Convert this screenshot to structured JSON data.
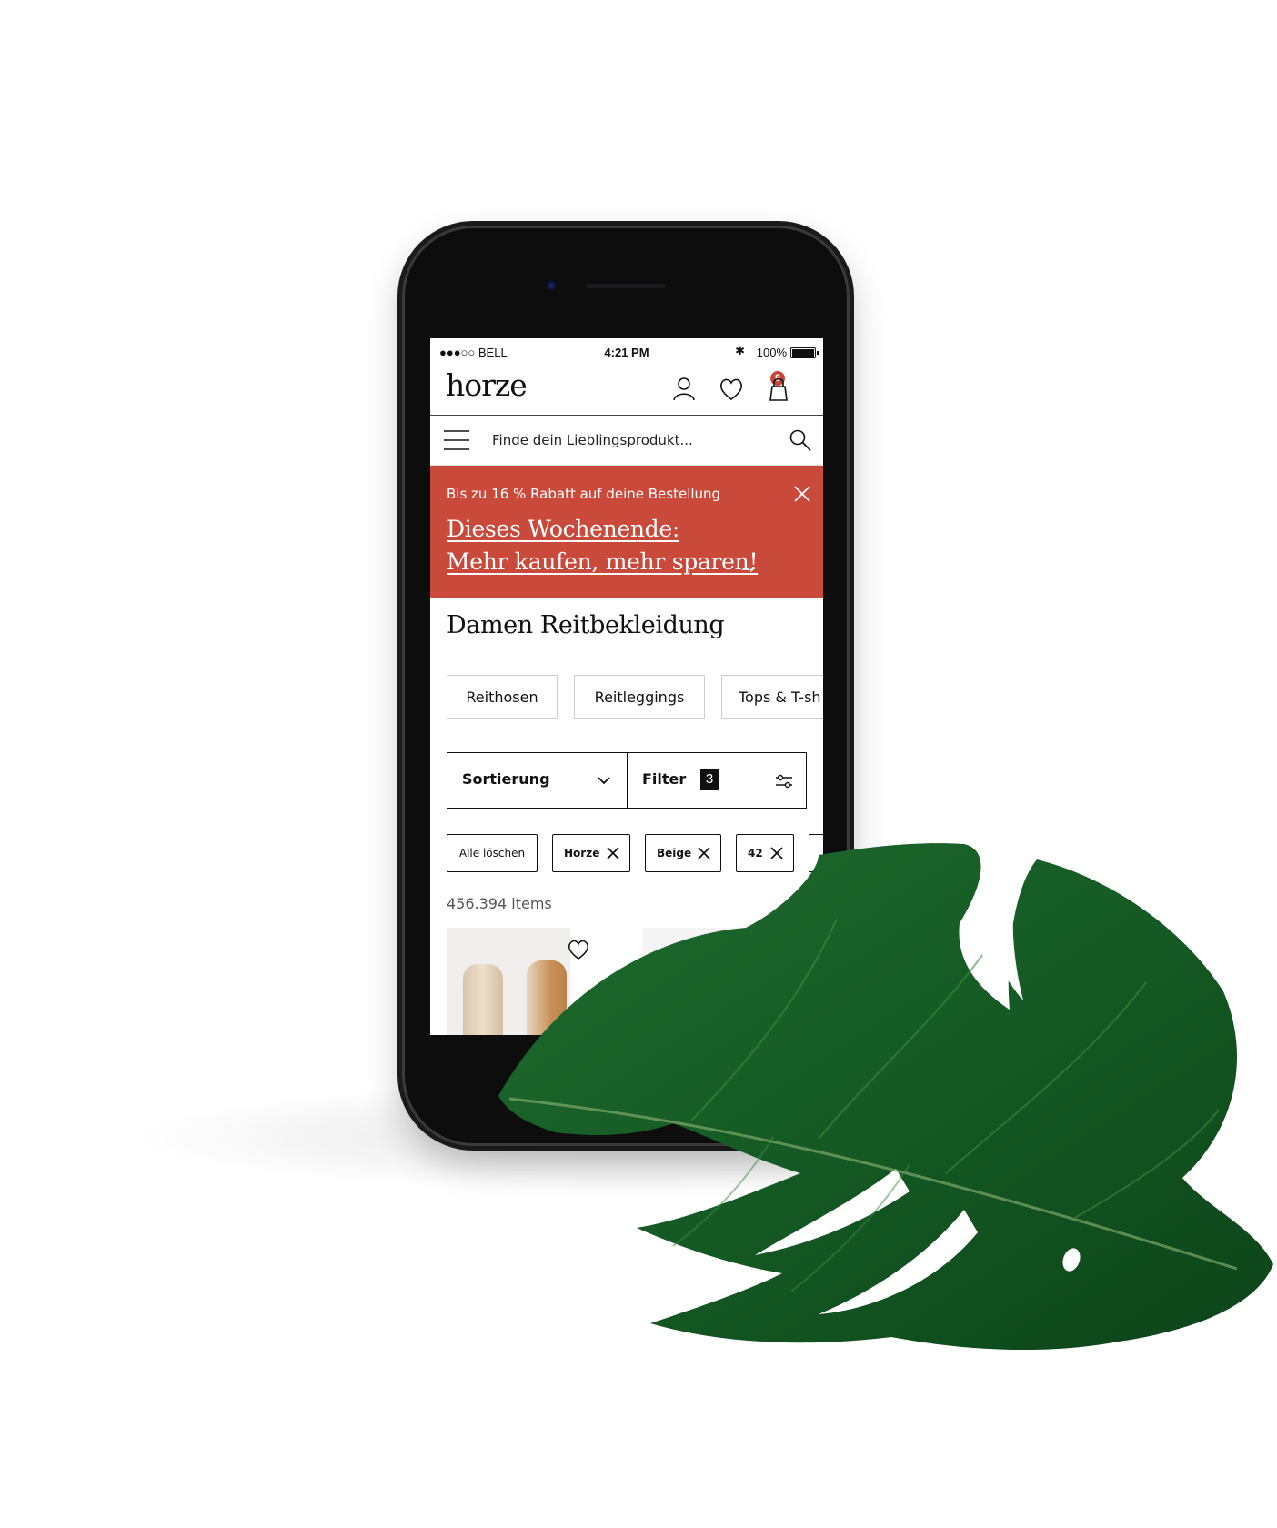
{
  "status_bar": {
    "carrier": "●●●○○ BELL",
    "time": "4:21 PM",
    "battery": "100%"
  },
  "header": {
    "logo": "horze",
    "wishlist_count": "8",
    "icons": [
      "account-icon",
      "heart-icon",
      "bag-icon"
    ]
  },
  "search": {
    "placeholder": "Finde dein Lieblingsprodukt..."
  },
  "promo": {
    "line1": "Bis zu 16 % Rabatt auf deine Bestellung",
    "headline_1": "Dieses Wochenende:",
    "headline_2": "Mehr kaufen, mehr sparen!",
    "arrow": "→",
    "color": "#c9493b"
  },
  "page": {
    "title": "Damen Reitbekleidung"
  },
  "categories": [
    "Reithosen",
    "Reitleggings",
    "Tops & T-sh"
  ],
  "controls": {
    "sort_label": "Sortierung",
    "filter_label": "Filter",
    "filter_count": "3"
  },
  "active_filters": {
    "clear_label": "Alle löschen",
    "tags": [
      "Horze",
      "Beige",
      "42"
    ]
  },
  "results": {
    "count_label": "456.394 items"
  }
}
